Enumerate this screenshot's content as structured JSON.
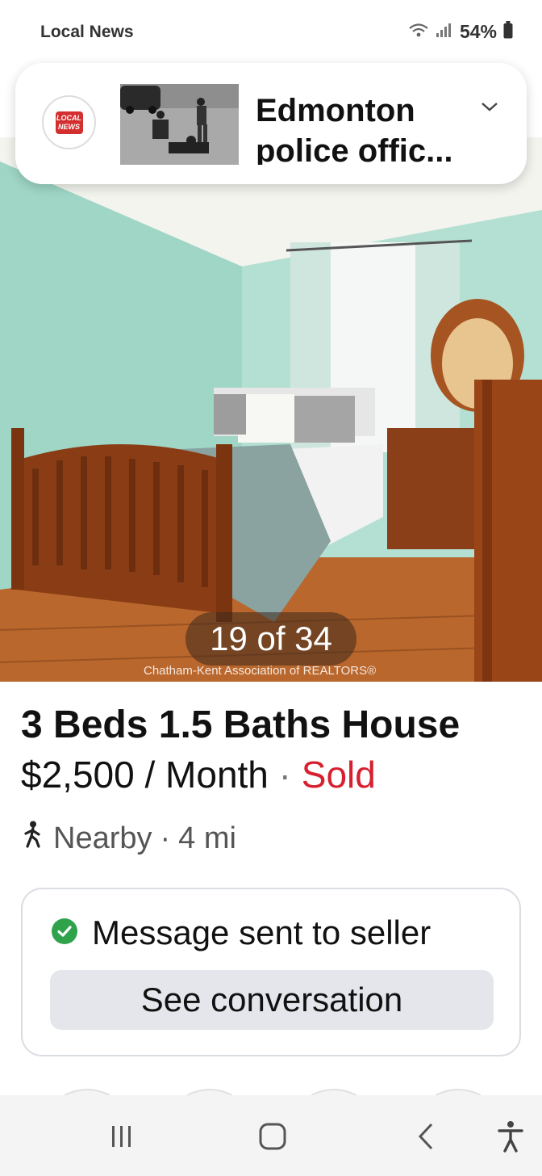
{
  "status_bar": {
    "app_name": "Local News",
    "battery": "54%"
  },
  "news_card": {
    "logo_text": "LOCAL NEWS",
    "headline": "Edmonton police offic..."
  },
  "photo": {
    "counter": "19 of 34",
    "watermark": "Chatham-Kent Association of REALTORS®"
  },
  "listing": {
    "title": "3 Beds 1.5 Baths House",
    "price": "$2,500 / Month",
    "separator": " · ",
    "status": "Sold",
    "status_color": "#d6202f",
    "nearby_label": "Nearby",
    "distance": "4 mi"
  },
  "message_card": {
    "status_text": "Message sent to seller",
    "check_color": "#31a24c",
    "button_label": "See conversation"
  },
  "nav_bar": {
    "icons": [
      "recent-apps-icon",
      "home-icon",
      "back-icon",
      "accessibility-icon"
    ]
  }
}
